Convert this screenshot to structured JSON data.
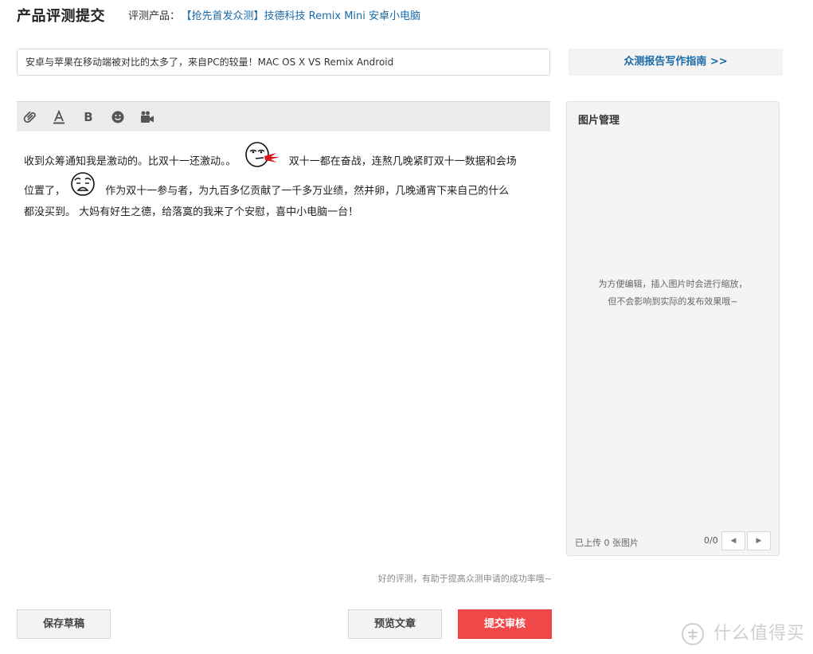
{
  "header": {
    "page_title": "产品评测提交",
    "product_label": "评测产品：",
    "product_name": "【抢先首发众测】技德科技 Remix Mini 安卓小电脑"
  },
  "title_input": {
    "value": "安卓与苹果在移动端被对比的太多了，来自PC的较量！MAC OS X VS Remix Android"
  },
  "guide_button": {
    "label": "众测报告写作指南 >>"
  },
  "toolbar": {
    "items": [
      {
        "name": "attach",
        "icon": "paperclip-icon"
      },
      {
        "name": "text-color",
        "icon": "text-color-icon",
        "glyph": "A"
      },
      {
        "name": "bold",
        "icon": "bold-icon",
        "glyph": "B"
      },
      {
        "name": "emoji",
        "icon": "smiley-icon"
      },
      {
        "name": "video",
        "icon": "video-camera-icon"
      }
    ]
  },
  "editor": {
    "line1_a": "收到众筹通知我是激动的。比双十一还激动。。",
    "line1_b": "双十一都在奋战，连熬几晚紧盯双十一数据和会场",
    "line2_a": "位置了，",
    "line2_b": "作为双十一参与者，为九百多亿贡献了一千多万业绩，然并卵，几晚通宵下来自己的什么",
    "line3": "都没买到。 大妈有好生之德，给落寞的我来了个安慰，喜中小电脑一台！",
    "emojis": [
      "spitting-blood-face-emoji",
      "sad-face-emoji"
    ]
  },
  "image_panel": {
    "title": "图片管理",
    "hint_line1": "为方便编辑，插入图片时会进行缩放，",
    "hint_line2": "但不会影响到实际的发布效果哦~",
    "upload_count": "已上传 0 张图片",
    "page_counter": "0/0",
    "prev_glyph": "◀",
    "next_glyph": "▶"
  },
  "helper_text": "好的评测，有助于提高众测申请的成功率哦~",
  "buttons": {
    "save_draft": "保存草稿",
    "preview": "预览文章",
    "submit": "提交审核"
  },
  "colors": {
    "link": "#1a6aa8",
    "submit": "#f04848",
    "panel_bg": "#f4f4f4",
    "toolbar_bg": "#ececec"
  },
  "watermark": {
    "text": "什么值得买"
  }
}
